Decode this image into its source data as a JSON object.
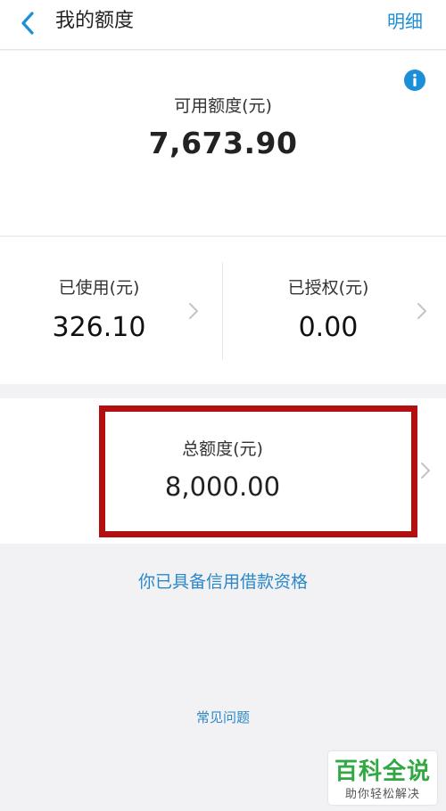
{
  "header": {
    "title": "我的额度",
    "detail_label": "明细"
  },
  "available": {
    "label": "可用额度(元)",
    "value": "7,673.90"
  },
  "used": {
    "label": "已使用(元)",
    "value": "326.10"
  },
  "authorized": {
    "label": "已授权(元)",
    "value": "0.00"
  },
  "total": {
    "label": "总额度(元)",
    "value": "8,000.00"
  },
  "qualification_text": "你已具备信用借款资格",
  "faq_label": "常见问题",
  "watermark": {
    "main": "百科全说",
    "sub": "助你轻松解决"
  },
  "icons": {
    "back": "chevron-left-icon",
    "info": "info-icon",
    "chevron": "chevron-right-icon"
  },
  "colors": {
    "accent": "#1c8fd8",
    "highlight_border": "#b40f0f",
    "watermark_green": "#31a843"
  }
}
